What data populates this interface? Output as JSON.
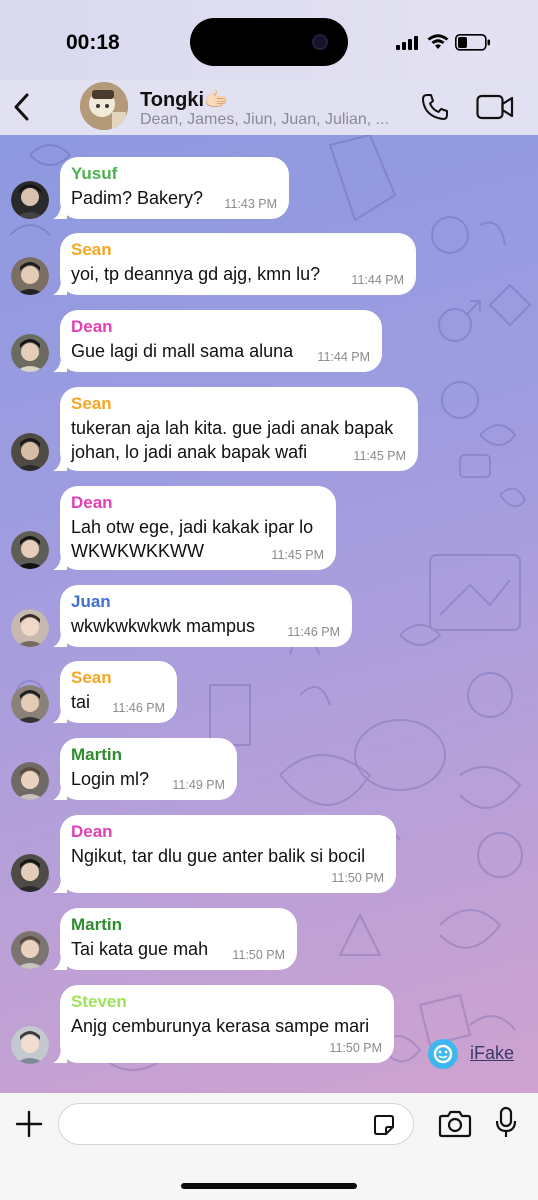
{
  "status": {
    "time": "00:18"
  },
  "header": {
    "title": "Tongki🫱🏻",
    "members": "Dean, James, Jiun, Juan, Julian, ..."
  },
  "colors": {
    "yusuf": "#4caf50",
    "sean": "#f5a623",
    "dean": "#e040b8",
    "juan": "#3f6fd0",
    "martin": "#2e8b2e",
    "steven": "#9ee35a"
  },
  "messages": [
    {
      "sender": "Yusuf",
      "text": "Padim? Bakery?",
      "time": "11:43 PM",
      "color": "#4caf50"
    },
    {
      "sender": "Sean",
      "text": "yoi, tp deannya gd ajg, kmn lu?",
      "time": "11:44 PM",
      "color": "#f5a623"
    },
    {
      "sender": "Dean",
      "text": "Gue lagi di mall sama aluna",
      "time": "11:44 PM",
      "color": "#e040b8"
    },
    {
      "sender": "Sean",
      "text_line1": "tukeran aja lah kita. gue jadi anak bapak",
      "text_line2": "johan, lo jadi anak bapak wafi",
      "time": "11:45 PM",
      "color": "#f5a623"
    },
    {
      "sender": "Dean",
      "text_line1": "Lah otw ege, jadi kakak ipar lo",
      "text_line2": "WKWKWKKWW",
      "time": "11:45 PM",
      "color": "#e040b8"
    },
    {
      "sender": "Juan",
      "text": "wkwkwkwkwk mampus",
      "time": "11:46 PM",
      "color": "#3f6fd0"
    },
    {
      "sender": "Sean",
      "text": "tai",
      "time": "11:46 PM",
      "color": "#f5a623"
    },
    {
      "sender": "Martin",
      "text": "Login ml?",
      "time": "11:49 PM",
      "color": "#2e8b2e"
    },
    {
      "sender": "Dean",
      "text": "Ngikut, tar dlu gue anter balik si bocil",
      "time": "11:50 PM",
      "color": "#e040b8"
    },
    {
      "sender": "Martin",
      "text": "Tai kata gue mah",
      "time": "11:50 PM",
      "color": "#2e8b2e"
    },
    {
      "sender": "Steven",
      "text": "Anjg cemburunya kerasa sampe mari",
      "time": "11:50 PM",
      "color": "#9ee35a"
    }
  ],
  "watermark": {
    "label": "iFake"
  },
  "input": {
    "placeholder": ""
  },
  "icons": [
    "back-icon",
    "phone-icon",
    "video-icon",
    "plus-icon",
    "sticker-icon",
    "camera-icon",
    "mic-icon"
  ]
}
